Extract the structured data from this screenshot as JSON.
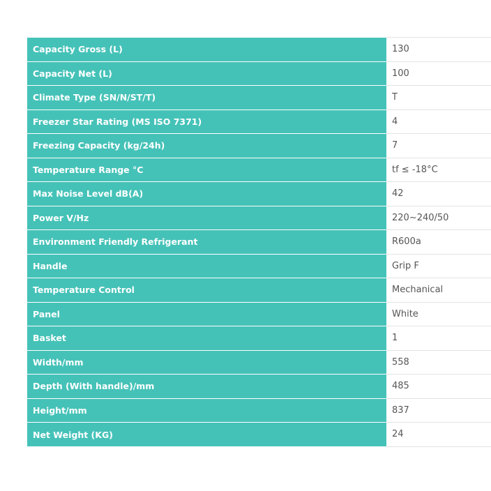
{
  "specs": [
    {
      "label": "Capacity Gross (L)",
      "value": "130"
    },
    {
      "label": "Capacity Net (L)",
      "value": "100"
    },
    {
      "label": "Climate Type (SN/N/ST/T)",
      "value": "T"
    },
    {
      "label": "Freezer Star Rating (MS ISO 7371)",
      "value": "4"
    },
    {
      "label": "Freezing Capacity (kg/24h)",
      "value": "7"
    },
    {
      "label": "Temperature Range °C",
      "value": "tf ≤ -18°C"
    },
    {
      "label": "Max Noise Level dB(A)",
      "value": "42"
    },
    {
      "label": "Power V/Hz",
      "value": "220~240/50"
    },
    {
      "label": "Environment Friendly Refrigerant",
      "value": "R600a"
    },
    {
      "label": "Handle",
      "value": "Grip F"
    },
    {
      "label": "Temperature Control",
      "value": "Mechanical"
    },
    {
      "label": "Panel",
      "value": "White"
    },
    {
      "label": "Basket",
      "value": "1"
    },
    {
      "label": "Width/mm",
      "value": "558"
    },
    {
      "label": "Depth (With handle)/mm",
      "value": "485"
    },
    {
      "label": "Height/mm",
      "value": "837"
    },
    {
      "label": "Net Weight (KG)",
      "value": "24"
    }
  ],
  "colors": {
    "label_background": "#45c2b8",
    "label_text": "#ffffff",
    "value_text": "#555555",
    "row_divider": "#e3e3e3"
  }
}
